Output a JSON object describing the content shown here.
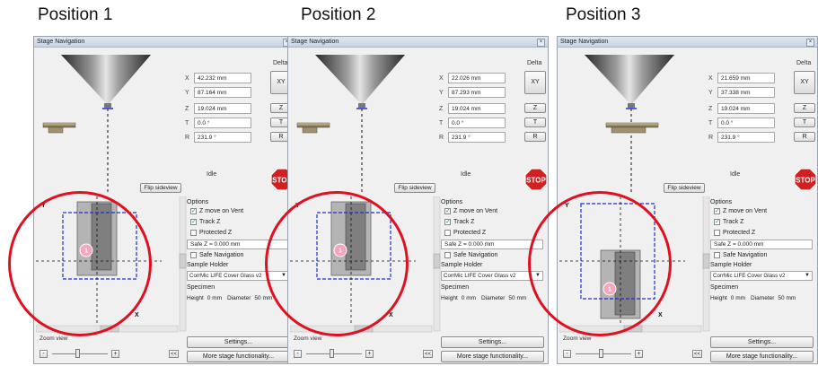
{
  "positions": [
    {
      "title": "Position 1",
      "window_title": "Stage Navigation",
      "x": "42.232 mm",
      "y": "87.164 mm",
      "z": "19.024 mm",
      "t": "0.0 °",
      "r": "231.9 °",
      "sample_dot_y": 0.42,
      "sample_dot_label": "1"
    },
    {
      "title": "Position 2",
      "window_title": "Stage Navigation",
      "x": "22.026 mm",
      "y": "87.293 mm",
      "z": "19.024 mm",
      "t": "0.0 °",
      "r": "231.9 °",
      "sample_dot_y": 0.42,
      "sample_dot_label": "1"
    },
    {
      "title": "Position 3",
      "window_title": "Stage Navigation",
      "x": "21.659 mm",
      "y": "37.338 mm",
      "z": "19.024 mm",
      "t": "0.0 °",
      "r": "231.9 °",
      "sample_dot_y": 0.85,
      "sample_dot_label": "1"
    }
  ],
  "common": {
    "delta_label": "Delta",
    "xy_button": "XY",
    "z_button": "Z",
    "t_button": "T",
    "r_button": "R",
    "coord_labels": [
      "X",
      "Y",
      "Z",
      "T",
      "R"
    ],
    "status": "Idle",
    "stop": "STOP",
    "flip_sideview": "Flip sideview",
    "options_label": "Options",
    "z_move_on_vent": "Z move on Vent",
    "track_z": "Track Z",
    "protected_z": "Protected Z",
    "safe_z": "Safe Z = 0.000 mm",
    "safe_navigation": "Safe Navigation",
    "sample_holder_label": "Sample Holder",
    "sample_holder_value": "CorrMic LIFE Cover Glass v2",
    "specimen_label": "Specimen",
    "height_label": "Height",
    "height_value": "0 mm",
    "diameter_label": "Diameter",
    "diameter_value": "50 mm",
    "settings": "Settings...",
    "more_stage": "More stage functionality...",
    "zoom_view": "Zoom view",
    "zoom_minus": "-",
    "zoom_plus": "+",
    "collapse": "<<",
    "axis_y": "Y",
    "axis_x": "X",
    "colors": {
      "stop_red": "#d21f1f",
      "accent_blue": "#1a2fd8",
      "highlight_red": "#e01020",
      "sample_pink": "#f3a6bd"
    }
  }
}
